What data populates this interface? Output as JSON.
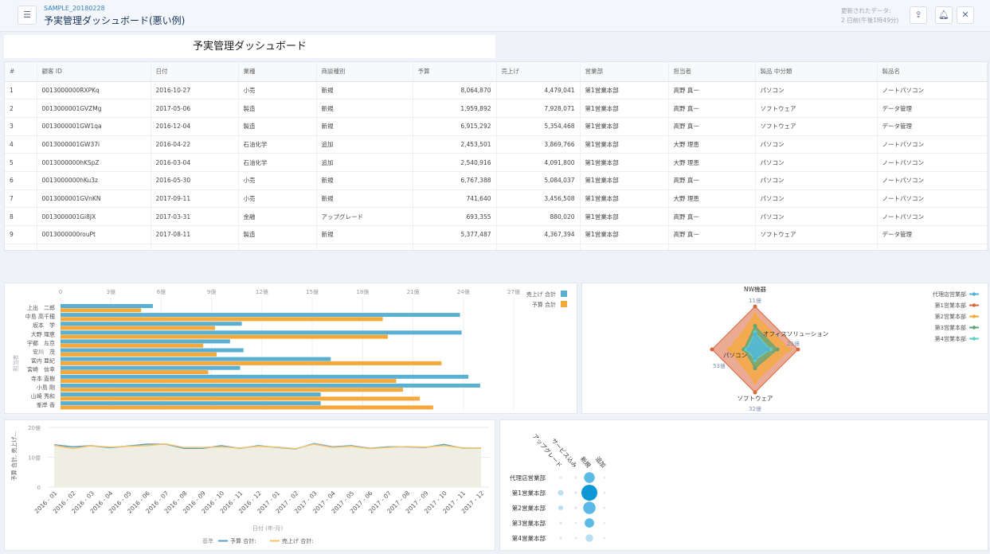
{
  "header": {
    "subtitle": "SAMPLE_20180228",
    "title": "予実管理ダッシュボード(悪い例)",
    "updated_label": "更新されたデータ:",
    "updated_value": "2 日前(午後1時49分)",
    "icons": [
      "list-icon",
      "share-icon",
      "bell-icon",
      "close-icon"
    ]
  },
  "dashboard_title": "予実管理ダッシュボード",
  "table": {
    "columns": [
      "#",
      "顧客 ID",
      "日付",
      "業種",
      "商談種別",
      "予算",
      "売上げ",
      "営業部",
      "担当者",
      "製品 中分類",
      "製品名"
    ],
    "rows": [
      [
        "1",
        "0013000000RXPKq",
        "2016-10-27",
        "小売",
        "新規",
        "8,064,870",
        "4,479,041",
        "第1営業本部",
        "高野 真一",
        "パソコン",
        "ノートパソコン"
      ],
      [
        "2",
        "0013000001GVZMg",
        "2017-05-06",
        "製造",
        "新規",
        "1,959,892",
        "7,928,071",
        "第1営業本部",
        "高野 真一",
        "ソフトウェア",
        "データ管理"
      ],
      [
        "3",
        "0013000001GW1qa",
        "2016-12-04",
        "製造",
        "新規",
        "6,915,292",
        "5,354,468",
        "第1営業本部",
        "高野 真一",
        "ソフトウェア",
        "データ管理"
      ],
      [
        "4",
        "0013000001GW37i",
        "2016-04-22",
        "石油化学",
        "追加",
        "2,453,501",
        "3,869,766",
        "第1営業本部",
        "大野 理恵",
        "パソコン",
        "ノートパソコン"
      ],
      [
        "5",
        "0013000000hKSpZ",
        "2016-03-04",
        "石油化学",
        "追加",
        "2,540,916",
        "4,091,800",
        "第1営業本部",
        "大野 理恵",
        "パソコン",
        "ノートパソコン"
      ],
      [
        "6",
        "0013000000hKu3z",
        "2016-05-30",
        "小売",
        "新規",
        "6,767,388",
        "5,084,037",
        "第1営業本部",
        "高野 真一",
        "パソコン",
        "ノートパソコン"
      ],
      [
        "7",
        "0013000001GVnKN",
        "2017-09-11",
        "小売",
        "新規",
        "741,640",
        "3,456,508",
        "第1営業本部",
        "大野 理恵",
        "パソコン",
        "ノートパソコン"
      ],
      [
        "8",
        "0013000001Gi8JX",
        "2017-03-31",
        "金融",
        "アップグレード",
        "693,355",
        "880,020",
        "第1営業本部",
        "高野 真一",
        "パソコン",
        "ノートパソコン"
      ],
      [
        "9",
        "0013000000rouPt",
        "2017-08-11",
        "製造",
        "新規",
        "5,377,487",
        "4,367,394",
        "第1営業本部",
        "高野 真一",
        "ソフトウェア",
        "データ管理"
      ]
    ]
  },
  "chart_data": [
    {
      "type": "bar",
      "orientation": "horizontal",
      "ylabel": "担当者",
      "categories": [
        "上出　二郎",
        "中島 高千穂",
        "坂本　学",
        "大野 理恵",
        "宇都　左京",
        "安川　茂",
        "宮内 亜紀",
        "宮崎　信幸",
        "寺本 直樹",
        "小島 剛",
        "山崎 秀和",
        "峯岸 香"
      ],
      "ticks": [
        "0",
        "3億",
        "6億",
        "9億",
        "12億",
        "15億",
        "18億",
        "21億",
        "24億",
        "27億"
      ],
      "xlim": [
        0,
        27
      ],
      "grid": true,
      "legend": "top-right",
      "series": [
        {
          "name": "売上げ 合計",
          "color": "#5ab0d2",
          "values": [
            5.5,
            23.8,
            10.8,
            23.9,
            10.1,
            10.9,
            16.1,
            10.7,
            24.3,
            25.0,
            15.5,
            15.5
          ]
        },
        {
          "name": "予算 合計",
          "color": "#f5a93a",
          "values": [
            4.8,
            19.2,
            9.2,
            19.5,
            8.5,
            9.3,
            22.7,
            8.8,
            20.0,
            20.4,
            21.4,
            22.2
          ]
        }
      ]
    },
    {
      "type": "radar",
      "axes": [
        {
          "label": "NW機器",
          "max_label": "11億",
          "max": 11
        },
        {
          "label": "オフィスソリューション",
          "max_label": "25億",
          "max": 25
        },
        {
          "label": "ソフトウェア",
          "max_label": "32億",
          "max": 32
        },
        {
          "label": "パソコン",
          "max_label": "53億",
          "max": 53
        }
      ],
      "legend": "top-right",
      "series": [
        {
          "name": "代理店営業部",
          "color": "#52b3d9",
          "values": [
            3.8,
            7.5,
            6.4,
            8
          ]
        },
        {
          "name": "第1営業本部",
          "color": "#d9653b",
          "values": [
            11,
            25,
            32,
            53
          ]
        },
        {
          "name": "第2営業本部",
          "color": "#f5a93a",
          "values": [
            8.8,
            20,
            24,
            32
          ]
        },
        {
          "name": "第3営業本部",
          "color": "#5fa37a",
          "values": [
            6,
            13,
            14,
            14
          ]
        },
        {
          "name": "第4営業本部",
          "color": "#5fd0c8",
          "values": [
            4.4,
            9,
            8,
            10.6
          ]
        }
      ]
    },
    {
      "type": "line",
      "xlabel": "日付 (年-月)",
      "ylabel": "予算 合計, 売上げ...",
      "ylim": [
        0,
        20
      ],
      "yticks": [
        "0",
        "10億",
        "20億"
      ],
      "legend_title": "基準",
      "legend": "bottom",
      "x": [
        "2016 - 01",
        "2016 - 02",
        "2016 - 03",
        "2016 - 04",
        "2016 - 05",
        "2016 - 06",
        "2016 - 07",
        "2016 - 08",
        "2016 - 09",
        "2016 - 10",
        "2016 - 11",
        "2016 - 12",
        "2017 - 01",
        "2017 - 02",
        "2017 - 03",
        "2017 - 04",
        "2017 - 05",
        "2017 - 06",
        "2017 - 07",
        "2017 - 08",
        "2017 - 09",
        "2017 - 10",
        "2017 - 11",
        "2017 - 12"
      ],
      "series": [
        {
          "name": "予算 合計:",
          "color": "#5a9fc0",
          "values": [
            14.2,
            13.5,
            13.9,
            13.2,
            13.8,
            14.4,
            14.4,
            13.0,
            13.0,
            13.9,
            13.0,
            13.9,
            13.3,
            12.8,
            14.6,
            13.5,
            13.9,
            13.0,
            13.5,
            13.5,
            13.3,
            14.3,
            13.1,
            13.1
          ]
        },
        {
          "name": "売上げ 合計:",
          "color": "#f5c26b",
          "values": [
            14.0,
            12.9,
            13.9,
            13.4,
            13.7,
            13.9,
            14.5,
            13.3,
            13.3,
            13.5,
            13.1,
            13.7,
            13.4,
            12.9,
            14.4,
            13.3,
            13.7,
            12.9,
            13.3,
            13.6,
            13.4,
            13.9,
            13.2,
            13.1
          ]
        }
      ]
    },
    {
      "type": "bubble",
      "columns": [
        "アップグレード",
        "サービス込み",
        "新規",
        "追加"
      ],
      "rows": [
        "代理店営業部",
        "第1営業本部",
        "第2営業本部",
        "第3営業本部",
        "第4営業本部"
      ],
      "values": [
        [
          0.03,
          0.02,
          0.45,
          0.01
        ],
        [
          0.12,
          0.03,
          1.0,
          0.02
        ],
        [
          0.09,
          0.03,
          0.6,
          0.02
        ],
        [
          0.03,
          0.02,
          0.35,
          0.01
        ],
        [
          0.03,
          0.02,
          0.22,
          0.01
        ]
      ]
    }
  ]
}
